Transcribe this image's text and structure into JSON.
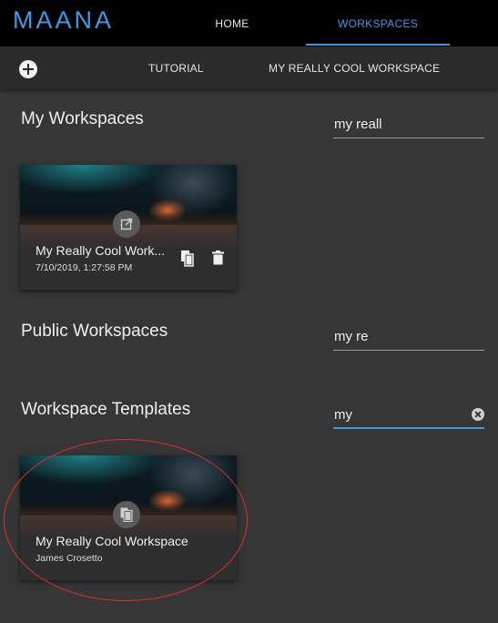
{
  "app": {
    "logo_text": "MAANA",
    "accent_color": "#3d9ae8"
  },
  "nav": {
    "home": "HOME",
    "workspaces": "WORKSPACES",
    "active": "WORKSPACES"
  },
  "subnav": {
    "add_icon": "add-circle-icon",
    "tabs": [
      "TUTORIAL",
      "MY REALLY COOL WORKSPACE"
    ]
  },
  "my_workspaces": {
    "title": "My Workspaces",
    "search_value": "my reall",
    "cards": [
      {
        "title": "My Really Cool Work...",
        "subtitle": "7/10/2019, 1:27:58 PM",
        "badge_icon": "open-external-icon",
        "actions": [
          "copy-icon",
          "delete-icon"
        ]
      }
    ]
  },
  "public_workspaces": {
    "title": "Public Workspaces",
    "search_value": "my re"
  },
  "workspace_templates": {
    "title": "Workspace Templates",
    "search_value": "my",
    "search_active": true,
    "cards": [
      {
        "title": "My Really Cool Workspace",
        "subtitle": "James Crosetto",
        "badge_icon": "copy-icon"
      }
    ]
  },
  "annotation": {
    "color": "#d9302a",
    "shape": "ellipse"
  }
}
